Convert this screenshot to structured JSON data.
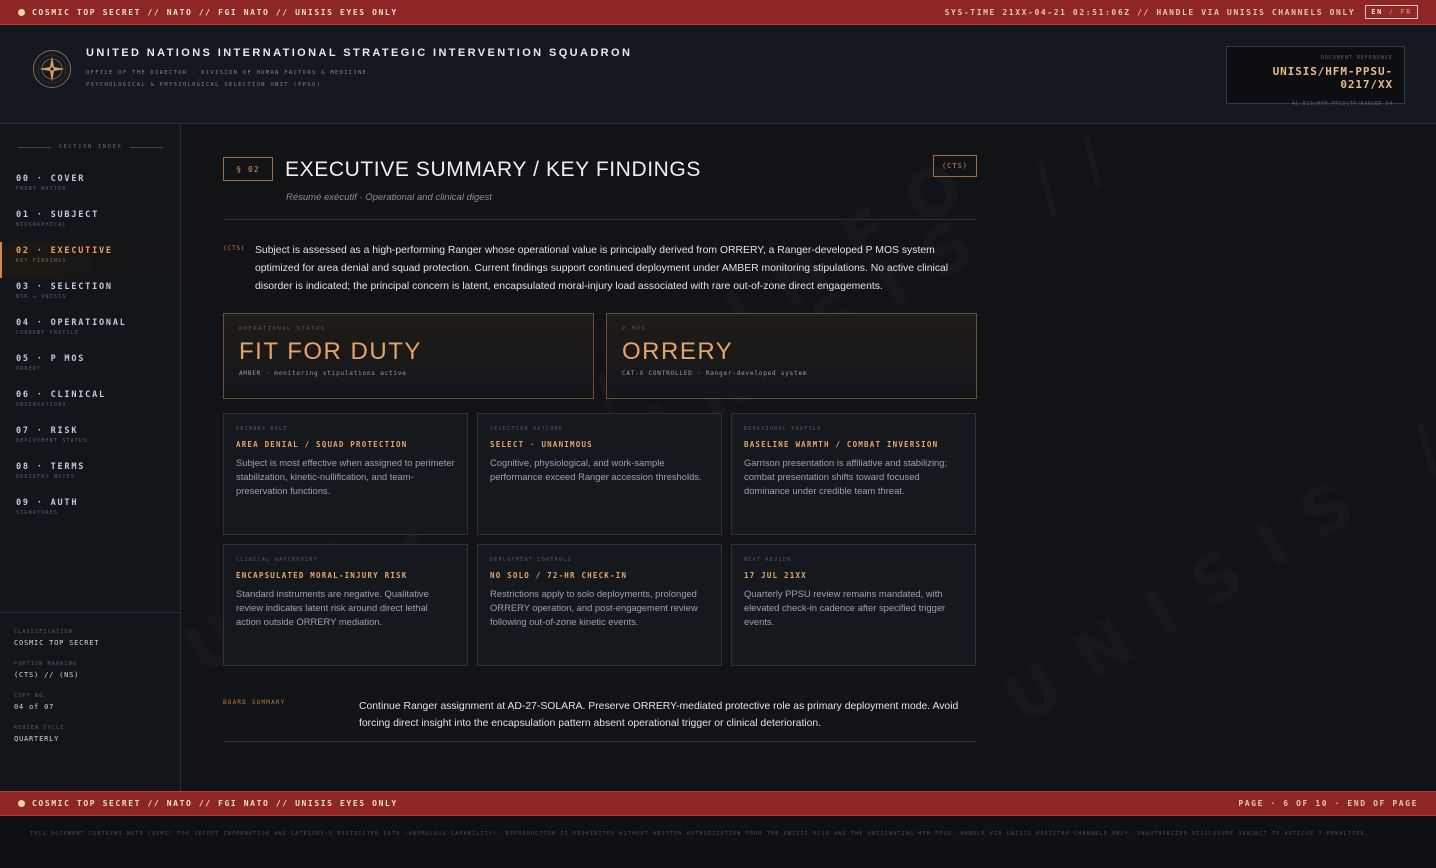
{
  "banner": {
    "top_left": "COSMIC TOP SECRET // NATO // FGI NATO // UNISIS EYES ONLY",
    "top_right": "SYS-TIME 21XX-04-21 02:51:06Z // HANDLE VIA UNISIS CHANNELS ONLY",
    "lang_active": "EN",
    "lang_sep": " / ",
    "lang_other": "FR",
    "bottom_left": "COSMIC TOP SECRET // NATO // FGI NATO // UNISIS EYES ONLY",
    "bottom_right": "PAGE · 6 OF 10 · END OF PAGE"
  },
  "header": {
    "org_name": "UNITED NATIONS INTERNATIONAL STRATEGIC INTERVENTION SQUADRON",
    "org_line1": "OFFICE OF THE DIRECTOR · DIVISION OF HUMAN FACTORS & MEDICINE",
    "org_line2": "PSYCHOLOGICAL & PHYSIOLOGICAL SELECTION UNIT (PPSU)",
    "docref_label": "DOCUMENT REFERENCE",
    "docref_value": "UNISIS/HFM-PPSU-0217/XX",
    "docref_sub": "AC:023(HFM-PPSU)TP/RANGER-04"
  },
  "sidebar": {
    "title": "SECTION INDEX",
    "items": [
      {
        "label": "00 · COVER",
        "sub": "FRONT MATTER"
      },
      {
        "label": "01 · SUBJECT",
        "sub": "BIOGRAPHICAL"
      },
      {
        "label": "02 · EXECUTIVE",
        "sub": "KEY FINDINGS"
      },
      {
        "label": "03 · SELECTION",
        "sub": "NSK → UNISIS"
      },
      {
        "label": "04 · OPERATIONAL",
        "sub": "CURRENT PROFILE"
      },
      {
        "label": "05 · P MOS",
        "sub": "ORRERY"
      },
      {
        "label": "06 · CLINICAL",
        "sub": "OBSERVATIONS"
      },
      {
        "label": "07 · RISK",
        "sub": "DEPLOYMENT STATUS"
      },
      {
        "label": "08 · TERMS",
        "sub": "REGISTRY NOTES"
      },
      {
        "label": "09 · AUTH",
        "sub": "SIGNATURES"
      }
    ],
    "meta": [
      {
        "label": "CLASSIFICATION",
        "value": "COSMIC TOP SECRET"
      },
      {
        "label": "PORTION MARKING",
        "value": "(CTS) // (NS)"
      },
      {
        "label": "COPY NO.",
        "value": "04 of 07"
      },
      {
        "label": "REVIEW CYCLE",
        "value": "QUARTERLY"
      }
    ]
  },
  "section": {
    "tag": "§ 02",
    "title": "EXECUTIVE SUMMARY / KEY FINDINGS",
    "subtitle": "Résumé exécutif · Operational and clinical digest",
    "badge": "(CTS)",
    "summary_mark": "(CTS)",
    "summary": "Subject is assessed as a high-performing Ranger whose operational value is principally derived from ORRERY, a Ranger-developed P MOS system optimized for area denial and squad protection. Current findings support continued deployment under AMBER monitoring stipulations. No active clinical disorder is indicated; the principal concern is latent, encapsulated moral-injury load associated with rare out-of-zone direct engagements."
  },
  "hero": [
    {
      "label": "OPERATIONAL STATUS",
      "value": "FIT FOR DUTY",
      "sub": "AMBER · monitoring stipulations active"
    },
    {
      "label": "P MOS",
      "value": "ORRERY",
      "sub": "CAT-X CONTROLLED · Ranger-developed system"
    }
  ],
  "cards": [
    {
      "label": "PRIMARY ROLE",
      "head": "AREA DENIAL / SQUAD PROTECTION",
      "body": "Subject is most effective when assigned to perimeter stabilization, kinetic-nullification, and team-preservation functions."
    },
    {
      "label": "SELECTION OUTCOME",
      "head": "SELECT · UNANIMOUS",
      "body": "Cognitive, physiological, and work-sample performance exceed Ranger accession thresholds."
    },
    {
      "label": "BEHAVIORAL PROFILE",
      "head": "BASELINE WARMTH / COMBAT INVERSION",
      "body": "Garrison presentation is affiliative and stabilizing; combat presentation shifts toward focused dominance under credible team threat."
    },
    {
      "label": "CLINICAL WATCHPOINT",
      "head": "ENCAPSULATED MORAL-INJURY RISK",
      "body": "Standard instruments are negative. Qualitative review indicates latent risk around direct lethal action outside ORRERY mediation."
    },
    {
      "label": "DEPLOYMENT CONTROLS",
      "head": "NO SOLO / 72-HR CHECK-IN",
      "body": "Restrictions apply to solo deployments, prolonged ORRERY operation, and post-engagement review following out-of-zone kinetic events."
    },
    {
      "label": "NEXT REVIEW",
      "head": "17 JUL 21XX",
      "body": "Quarterly PPSU review remains mandated, with elevated check-in cadence after specified trigger events."
    }
  ],
  "board": {
    "label": "BOARD SUMMARY",
    "text": "Continue Ranger assignment at AD-27-SOLARA. Preserve ORRERY-mediated protective role as primary deployment mode. Avoid forcing direct insight into the encapsulation pattern absent operational trigger or clinical deterioration."
  },
  "footer": {
    "text": "THIS DOCUMENT CONTAINS NATO COSMIC TOP SECRET INFORMATION AND CATEGORY-X RESTRICTED DATA (ANOMALOUS CAPABILITY). REPRODUCTION IS PROHIBITED WITHOUT WRITTEN AUTHORIZATION FROM THE UNISIS DCSR AND THE ORIGINATING HFM-PPSU. HANDLE VIA UNISIS REGISTRY CHANNELS ONLY. UNAUTHORIZED DISCLOSURE SUBJECT TO ARTICLE 7 PENALTIES."
  },
  "watermark": "UNISIS // INFO",
  "colors": {
    "banner": "#8f2626",
    "accent": "#e2a769",
    "background": "#111317"
  }
}
